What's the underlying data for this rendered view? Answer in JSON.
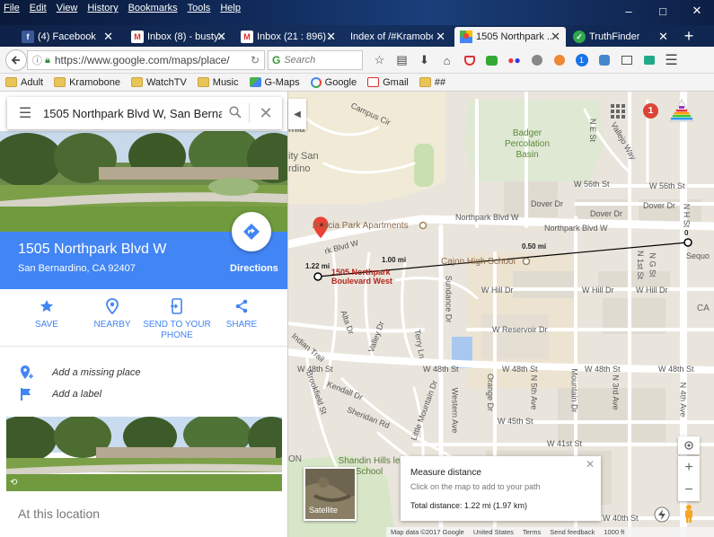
{
  "menu": [
    "File",
    "Edit",
    "View",
    "History",
    "Bookmarks",
    "Tools",
    "Help"
  ],
  "window_controls": {
    "minimize": "–",
    "maximize": "□",
    "close": "✕"
  },
  "tabs": [
    {
      "label": "(4) Facebook",
      "icon": "facebook-icon",
      "active": false
    },
    {
      "label": "Inbox (8) - busty...",
      "icon": "gmail-icon",
      "active": false
    },
    {
      "label": "Inbox (21 : 896) ...",
      "icon": "gmail-icon",
      "active": false
    },
    {
      "label": "Index of /#Kramobo...",
      "icon": "",
      "active": false
    },
    {
      "label": "1505 Northpark ...",
      "icon": "google-maps-icon",
      "active": true
    },
    {
      "label": "TruthFinder",
      "icon": "truthfinder-icon",
      "active": false
    }
  ],
  "new_tab": "+",
  "url": "https://www.google.com/maps/place/",
  "search_placeholder": "Search",
  "bookmarks": [
    {
      "label": "Adult",
      "icon": "folder-icon"
    },
    {
      "label": "Kramobone",
      "icon": "folder-icon"
    },
    {
      "label": "WatchTV",
      "icon": "folder-icon"
    },
    {
      "label": "Music",
      "icon": "folder-icon"
    },
    {
      "label": "G-Maps",
      "icon": "google-maps-icon"
    },
    {
      "label": "Google",
      "icon": "google-icon"
    },
    {
      "label": "Gmail",
      "icon": "gmail-icon"
    },
    {
      "label": "##",
      "icon": "folder-icon"
    }
  ],
  "panel": {
    "search_value": "1505 Northpark Blvd W, San Bernardino",
    "place_title": "1505 Northpark Blvd W",
    "place_subtitle": "San Bernardino, CA 92407",
    "directions_label": "Directions",
    "actions": [
      {
        "label": "SAVE",
        "icon": "star-icon"
      },
      {
        "label": "NEARBY",
        "icon": "nearby-icon"
      },
      {
        "label": "SEND TO YOUR PHONE",
        "icon": "send-to-phone-icon"
      },
      {
        "label": "SHARE",
        "icon": "share-icon"
      }
    ],
    "add_missing_place": "Add a missing place",
    "add_label": "Add a label",
    "at_this_location": "At this location"
  },
  "map": {
    "notification_count": "1",
    "labels": {
      "badger": "Badger Percolation Basin",
      "acacia": "Acacia Park Apartments",
      "cajon": "Cajon High School",
      "shandin": "Shandin Hills le School",
      "marker": "1505 Northpark Boulevard West",
      "northpark1": "Northpark Blvd W",
      "northpark2": "Northpark Blvd W",
      "northpark3": "rk Blvd W",
      "w56a": "W 56th St",
      "w56b": "W 56th St",
      "dover1": "Dover Dr",
      "dover2": "Dover Dr",
      "dover3": "Dover Dr",
      "hill1": "W Hill Dr",
      "hill2": "W Hill Dr",
      "hill3": "W Hill Dr",
      "reservoir": "W Reservoir Dr",
      "w48a": "W 48th St",
      "w48b": "W 48th St",
      "w48c": "W 48th St",
      "w48d": "W 48th St",
      "w48e": "W 48th St",
      "w45": "W 45th St",
      "w41": "W 41st St",
      "w40": "W 40th St",
      "campus": "Campus Cir",
      "indian": "Indian Trail",
      "alta": "Alta Dr",
      "valley": "Valley Dr",
      "terry": "Terry Ln",
      "sundance": "Sundance Dr",
      "little": "Little Mountain Dr",
      "western": "Western Ave",
      "orange": "Orange Dr",
      "mountain": "Mountain Dr",
      "third": "N 3rd Ave",
      "fifth": "N 5th Ave",
      "n4th": "N 4th Ave",
      "n1st": "N 1st St",
      "nhst": "N H St",
      "ngst": "N G St",
      "nest": "N E St",
      "valejo": "Vallejo Way",
      "brookfield": "Brookfield St",
      "sheridan": "Sheridan Rd",
      "kendall": "Kendall Dr",
      "sequoia": "Sequo",
      "cal": "CA",
      "sann": "rnia",
      "sanp": "ity San",
      "sand": "rdino",
      "r": "ON",
      "university": "University"
    },
    "measure_labels": [
      "1.22 mi",
      "1.00 mi",
      "0.50 mi",
      "0"
    ],
    "measure_card": {
      "title": "Measure distance",
      "subtitle": "Click on the map to add to your path",
      "total": "Total distance: 1.22 mi (1.97 km)"
    },
    "satellite_label": "Satellite",
    "footer": [
      "Map data ©2017 Google",
      "United States",
      "Terms",
      "Send feedback",
      "1000 ft"
    ],
    "zoom_in": "+",
    "zoom_out": "−",
    "colors": {
      "road": "#ffffff",
      "park": "#c8e0b0",
      "water": "#a8c8f0",
      "campus": "#f0ead6",
      "building": "#e0dbd0"
    }
  }
}
